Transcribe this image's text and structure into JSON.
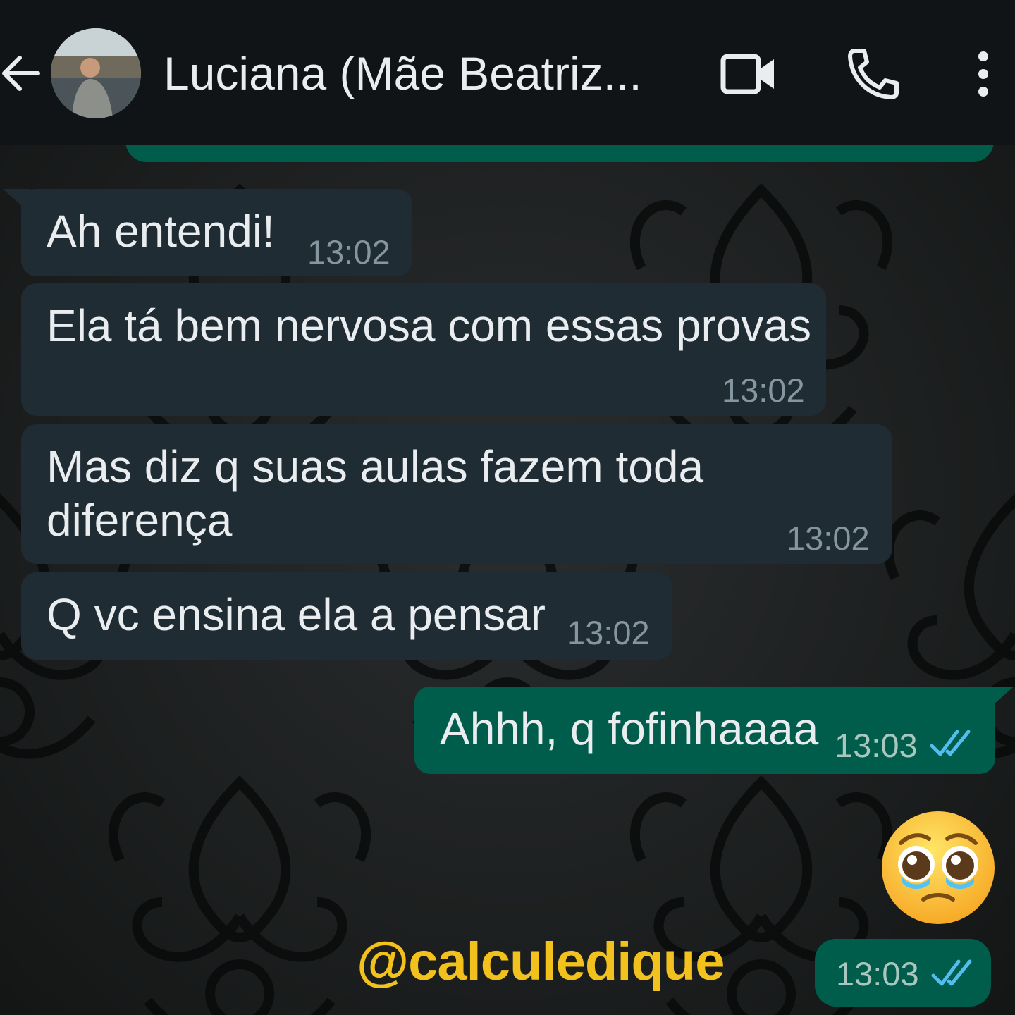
{
  "header": {
    "contact_name": "Luciana (Mãe Beatriz...",
    "icons": [
      "back-arrow-icon",
      "avatar",
      "video-camera-icon",
      "phone-icon",
      "more-vertical-icon"
    ]
  },
  "messages": [
    {
      "direction": "incoming",
      "text": "Ah entendi!",
      "time": "13:02"
    },
    {
      "direction": "incoming",
      "text": "Ela tá bem nervosa com essas provas",
      "time": "13:02"
    },
    {
      "direction": "incoming",
      "text_line1": "Mas diz q suas aulas fazem toda",
      "text_line2": "diferença",
      "time": "13:02"
    },
    {
      "direction": "incoming",
      "text": "Q vc ensina ela a pensar",
      "time": "13:02"
    },
    {
      "direction": "outgoing",
      "text": "Ahhh, q fofinhaaaa",
      "time": "13:03",
      "status": "read"
    },
    {
      "direction": "outgoing",
      "emoji": "pleading-face-with-tears",
      "time": "13:03",
      "status": "read"
    }
  ],
  "watermark": "@calculedique",
  "colors": {
    "header_bg": "#101417",
    "incoming_bubble": "#202c33",
    "outgoing_bubble": "#005c4b",
    "read_ticks": "#53bdeb",
    "watermark": "#f3c11d"
  }
}
